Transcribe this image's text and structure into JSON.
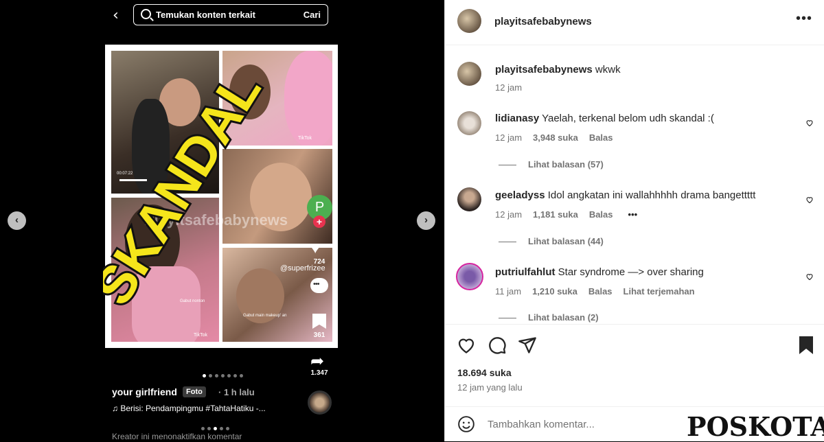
{
  "search": {
    "placeholder": "Temukan konten terkait",
    "button": "Cari"
  },
  "post_image": {
    "overlay_text": "SKANDAL???",
    "watermark": "Playitsafebabynews",
    "tiktok_label": "TikTok",
    "handle": "@superfrizee",
    "caption_small_1": "Gabut nonton",
    "caption_small_2": "Gabut main makeup' an",
    "time_code": "00:07:22"
  },
  "phone_sidebar": {
    "profile_initial": "P",
    "likes": "724",
    "saves": "361",
    "shares": "1.347"
  },
  "phone_post": {
    "author": "your girlfriend",
    "badge": "Foto",
    "time_ago": "· 1 h lalu",
    "music": "♫  Berisi: Pendampingmu #TahtaHatiku -...",
    "creator_note": "Kreator ini menonaktifkan komentar"
  },
  "header": {
    "username": "playitsafebabynews"
  },
  "caption": {
    "username": "playitsafebabynews",
    "text": "wkwk",
    "time": "12 jam"
  },
  "comments": [
    {
      "username": "lidianasy",
      "text": "Yaelah, terkenal belom udh skandal :(",
      "time": "12 jam",
      "likes": "3,948 suka",
      "reply": "Balas",
      "view_replies": "Lihat balasan (57)"
    },
    {
      "username": "geeladyss",
      "text": "Idol angkatan ini wallahhhhh drama bangettttt",
      "time": "12 jam",
      "likes": "1,181 suka",
      "reply": "Balas",
      "more": "•••",
      "view_replies": "Lihat balasan (44)"
    },
    {
      "username": "putriulfahlut",
      "text": "Star syndrome —> over sharing",
      "time": "11 jam",
      "likes": "1,210 suka",
      "reply": "Balas",
      "translate": "Lihat terjemahan",
      "view_replies": "Lihat balasan (2)"
    }
  ],
  "stats": {
    "likes": "18.694 suka",
    "posted": "12 jam yang lalu"
  },
  "add_comment": {
    "placeholder": "Tambahkan komentar..."
  },
  "logo": {
    "text": "POSKOTA"
  },
  "colors": {
    "accent_pink": "#e8334f",
    "skandal_yellow": "#f5e51b",
    "text_dark": "#262626",
    "text_muted": "#737373"
  }
}
